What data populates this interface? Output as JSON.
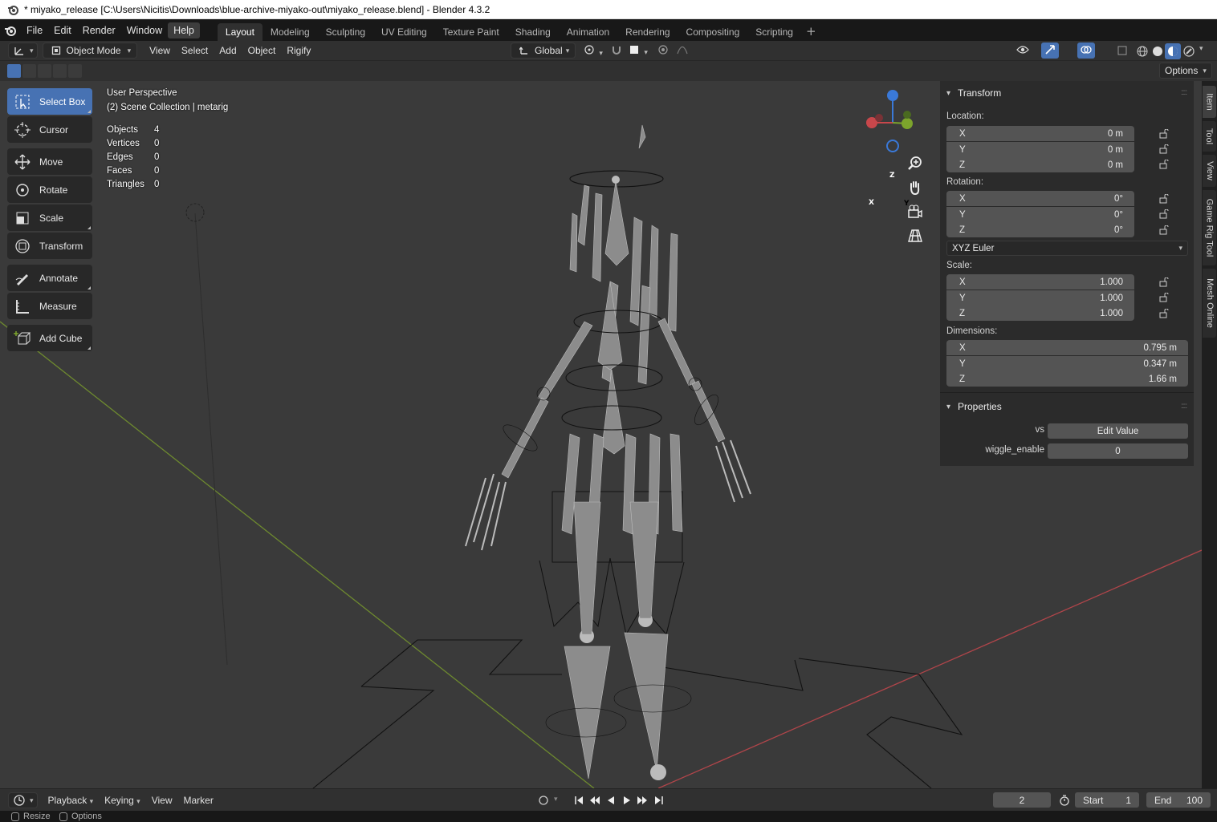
{
  "window": {
    "title": "* miyako_release [C:\\Users\\Nicitis\\Downloads\\blue-archive-miyako-out\\miyako_release.blend] - Blender 4.3.2"
  },
  "menu": [
    "File",
    "Edit",
    "Render",
    "Window",
    "Help"
  ],
  "workspaces": [
    "Layout",
    "Modeling",
    "Sculpting",
    "UV Editing",
    "Texture Paint",
    "Shading",
    "Animation",
    "Rendering",
    "Compositing",
    "Scripting"
  ],
  "workspace_add": "+",
  "header": {
    "mode": "Object Mode",
    "menus": [
      "View",
      "Select",
      "Add",
      "Object",
      "Rigify"
    ],
    "orientation": "Global",
    "options": "Options"
  },
  "toolbar": [
    "Select Box",
    "Cursor",
    "Move",
    "Rotate",
    "Scale",
    "Transform",
    "Annotate",
    "Measure",
    "Add Cube"
  ],
  "overlay": {
    "view_name": "User Perspective",
    "collection": "(2) Scene Collection | metarig",
    "stats": [
      {
        "label": "Objects",
        "value": "4"
      },
      {
        "label": "Vertices",
        "value": "0"
      },
      {
        "label": "Edges",
        "value": "0"
      },
      {
        "label": "Faces",
        "value": "0"
      },
      {
        "label": "Triangles",
        "value": "0"
      }
    ]
  },
  "gizmo": {
    "x": "X",
    "y": "Y",
    "z": "Z"
  },
  "transform_panel": {
    "title": "Transform",
    "location_label": "Location:",
    "location": [
      {
        "axis": "X",
        "value": "0 m"
      },
      {
        "axis": "Y",
        "value": "0 m"
      },
      {
        "axis": "Z",
        "value": "0 m"
      }
    ],
    "rotation_label": "Rotation:",
    "rotation": [
      {
        "axis": "X",
        "value": "0°"
      },
      {
        "axis": "Y",
        "value": "0°"
      },
      {
        "axis": "Z",
        "value": "0°"
      }
    ],
    "rotation_mode": "XYZ Euler",
    "scale_label": "Scale:",
    "scale": [
      {
        "axis": "X",
        "value": "1.000"
      },
      {
        "axis": "Y",
        "value": "1.000"
      },
      {
        "axis": "Z",
        "value": "1.000"
      }
    ],
    "dimensions_label": "Dimensions:",
    "dimensions": [
      {
        "axis": "X",
        "value": "0.795 m"
      },
      {
        "axis": "Y",
        "value": "0.347 m"
      },
      {
        "axis": "Z",
        "value": "1.66 m"
      }
    ]
  },
  "properties_panel": {
    "title": "Properties",
    "rows": [
      {
        "label": "vs",
        "value": "Edit Value"
      },
      {
        "label": "wiggle_enable",
        "value": "0"
      }
    ]
  },
  "side_tabs": [
    "Item",
    "Tool",
    "View",
    "Game Rig Tool",
    "Mesh Online"
  ],
  "timeline": {
    "menus": [
      "Playback",
      "Keying",
      "View",
      "Marker"
    ],
    "current_frame": "2",
    "start_label": "Start",
    "start": "1",
    "end_label": "End",
    "end": "100"
  },
  "statusbar": {
    "resize": "Resize",
    "options": "Options"
  },
  "colors": {
    "accent": "#4772b3",
    "x_axis": "#c8474b",
    "y_axis": "#7ca42c",
    "z_axis": "#3a79d8"
  }
}
